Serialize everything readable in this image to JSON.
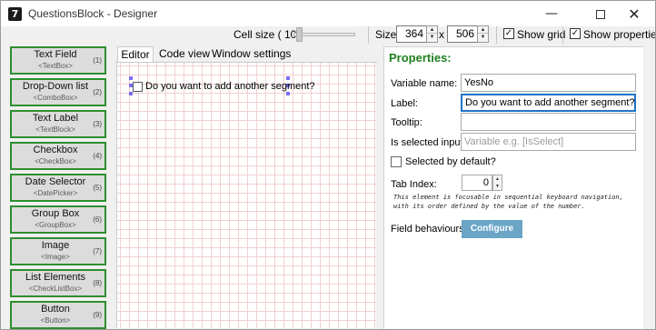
{
  "window": {
    "title": "QuestionsBlock - Designer",
    "app_icon": "7",
    "controls": {
      "minimize": "—",
      "close": "✕"
    }
  },
  "toolbar": {
    "cell_size_label": "Cell size ( 10 )",
    "cell_size_value": 10,
    "size_label": "Size:",
    "width": "364",
    "height": "506",
    "x_label": "x",
    "show_grid_label": "Show grid",
    "show_grid_checked": true,
    "show_properties_label": "Show properties",
    "show_properties_checked": true
  },
  "toolbox": [
    {
      "name": "Text Field",
      "class": "<TextBox>",
      "shortcut": "(1)"
    },
    {
      "name": "Drop-Down list",
      "class": "<ComboBox>",
      "shortcut": "(2)"
    },
    {
      "name": "Text Label",
      "class": "<TextBlock>",
      "shortcut": "(3)"
    },
    {
      "name": "Checkbox",
      "class": "<CheckBox>",
      "shortcut": "(4)"
    },
    {
      "name": "Date Selector",
      "class": "<DatePicker>",
      "shortcut": "(5)"
    },
    {
      "name": "Group Box",
      "class": "<GroupBox>",
      "shortcut": "(6)"
    },
    {
      "name": "Image",
      "class": "<Image>",
      "shortcut": "(7)"
    },
    {
      "name": "List Elements",
      "class": "<CheckListBox>",
      "shortcut": "(8)"
    },
    {
      "name": "Button",
      "class": "<Button>",
      "shortcut": "(9)"
    }
  ],
  "tabs": [
    {
      "label": "Editor",
      "active": true
    },
    {
      "label": "Code view",
      "active": false
    },
    {
      "label": "Window settings",
      "active": false
    }
  ],
  "canvas": {
    "grid_color": "#f1d0d0",
    "selected_element": {
      "type": "checkbox",
      "label": "Do you want to add another segment?"
    }
  },
  "properties": {
    "title": "Properties:",
    "variable_name_label": "Variable name:",
    "variable_name_value": "YesNo",
    "label_label": "Label:",
    "label_value": "Do you want to add another segment?",
    "tooltip_label": "Tooltip:",
    "tooltip_value": "",
    "is_selected_input_label": "Is selected input:",
    "is_selected_input_placeholder": "Variable e.g. [IsSelect]",
    "selected_by_default_label": "Selected by default?",
    "selected_by_default_checked": false,
    "tab_index_label": "Tab Index:",
    "tab_index_value": "0",
    "help_text_line1": "This element is focusable in sequential keyboard navigation,",
    "help_text_line2": "with its order defined by the value of the number.",
    "field_behaviours_label": "Field behaviours:",
    "configure_label": "Configure"
  },
  "colors": {
    "toolbox_border": "#2f8e2f",
    "properties_title": "#1e7f1e",
    "configure_button": "#6aa5c6",
    "focus_border": "#1f74c8"
  }
}
